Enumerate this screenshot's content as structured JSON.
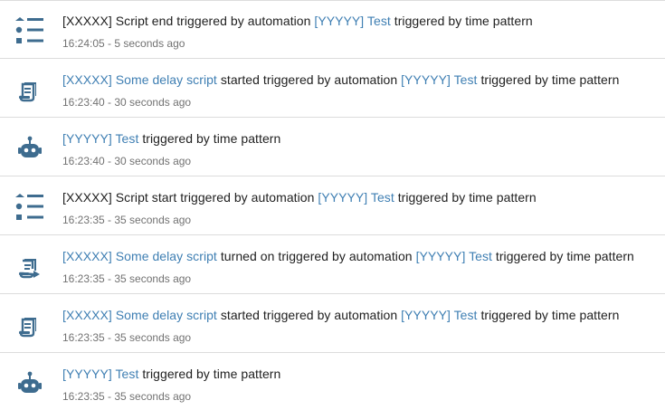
{
  "colors": {
    "icon": "#3e6c8f",
    "link": "#3f7fb3",
    "text": "#212121",
    "secondary": "#727272",
    "divider": "#dcdcdc"
  },
  "entries": [
    {
      "icon": "format-list-bulleted-icon",
      "parts": [
        {
          "text": "[XXXXX] Script end triggered by automation ",
          "link": false
        },
        {
          "text": "[YYYYY] Test",
          "link": true
        },
        {
          "text": " triggered by time pattern",
          "link": false
        }
      ],
      "time": "16:24:05 - 5 seconds ago"
    },
    {
      "icon": "script-text-icon",
      "parts": [
        {
          "text": "[XXXXX] Some delay script",
          "link": true
        },
        {
          "text": " started triggered by automation ",
          "link": false
        },
        {
          "text": "[YYYYY] Test",
          "link": true
        },
        {
          "text": " triggered by time pattern",
          "link": false
        }
      ],
      "time": "16:23:40 - 30 seconds ago"
    },
    {
      "icon": "robot-icon",
      "parts": [
        {
          "text": "[YYYYY] Test",
          "link": true
        },
        {
          "text": " triggered by time pattern",
          "link": false
        }
      ],
      "time": "16:23:40 - 30 seconds ago"
    },
    {
      "icon": "format-list-bulleted-icon",
      "parts": [
        {
          "text": "[XXXXX] Script start triggered by automation ",
          "link": false
        },
        {
          "text": "[YYYYY] Test",
          "link": true
        },
        {
          "text": " triggered by time pattern",
          "link": false
        }
      ],
      "time": "16:23:35 - 35 seconds ago"
    },
    {
      "icon": "script-play-icon",
      "parts": [
        {
          "text": "[XXXXX] Some delay script",
          "link": true
        },
        {
          "text": " turned on triggered by automation ",
          "link": false
        },
        {
          "text": "[YYYYY] Test",
          "link": true
        },
        {
          "text": " triggered by time pattern",
          "link": false
        }
      ],
      "time": "16:23:35 - 35 seconds ago"
    },
    {
      "icon": "script-text-icon",
      "parts": [
        {
          "text": "[XXXXX] Some delay script",
          "link": true
        },
        {
          "text": " started triggered by automation ",
          "link": false
        },
        {
          "text": "[YYYYY] Test",
          "link": true
        },
        {
          "text": " triggered by time pattern",
          "link": false
        }
      ],
      "time": "16:23:35 - 35 seconds ago"
    },
    {
      "icon": "robot-icon",
      "parts": [
        {
          "text": "[YYYYY] Test",
          "link": true
        },
        {
          "text": " triggered by time pattern",
          "link": false
        }
      ],
      "time": "16:23:35 - 35 seconds ago"
    }
  ]
}
